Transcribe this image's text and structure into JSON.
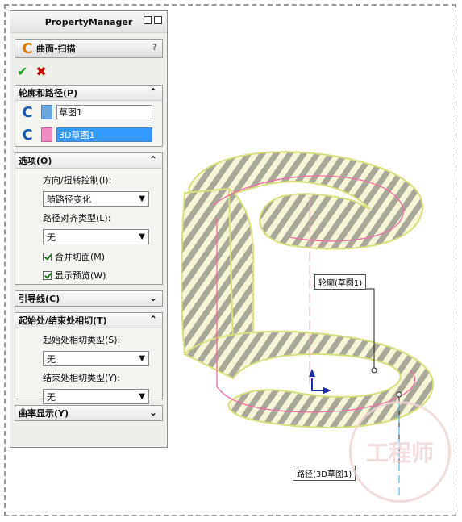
{
  "property_manager": {
    "title": "PropertyManager",
    "feature_title": "曲面-扫描",
    "help": "?",
    "sections": {
      "profile_path": {
        "title": "轮廓和路径(P)",
        "profile_value": "草图1",
        "path_value": "3D草图1"
      },
      "options": {
        "title": "选项(O)",
        "direction_label": "方向/扭转控制(I):",
        "direction_value": "随路径变化",
        "path_align_label": "路径对齐类型(L):",
        "path_align_value": "无",
        "merge_label": "合并切面(M)",
        "preview_label": "显示预览(W)"
      },
      "guides": {
        "title": "引导线(C)"
      },
      "tangency": {
        "title": "起始处/结束处相切(T)",
        "start_label": "起始处相切类型(S):",
        "start_value": "无",
        "end_label": "结束处相切类型(Y):",
        "end_value": "无"
      },
      "curvature": {
        "title": "曲率显示(Y)"
      }
    }
  },
  "annotations": {
    "profile": "轮廓(草图1)",
    "path": "路径(3D草图1)"
  },
  "watermark": "工程师",
  "colors": {
    "accent_blue": "#3399ff",
    "profile_blue": "#6aa7e0",
    "path_pink": "#f08ac0",
    "ok_green": "#189b1c",
    "cancel_red": "#c70000"
  }
}
